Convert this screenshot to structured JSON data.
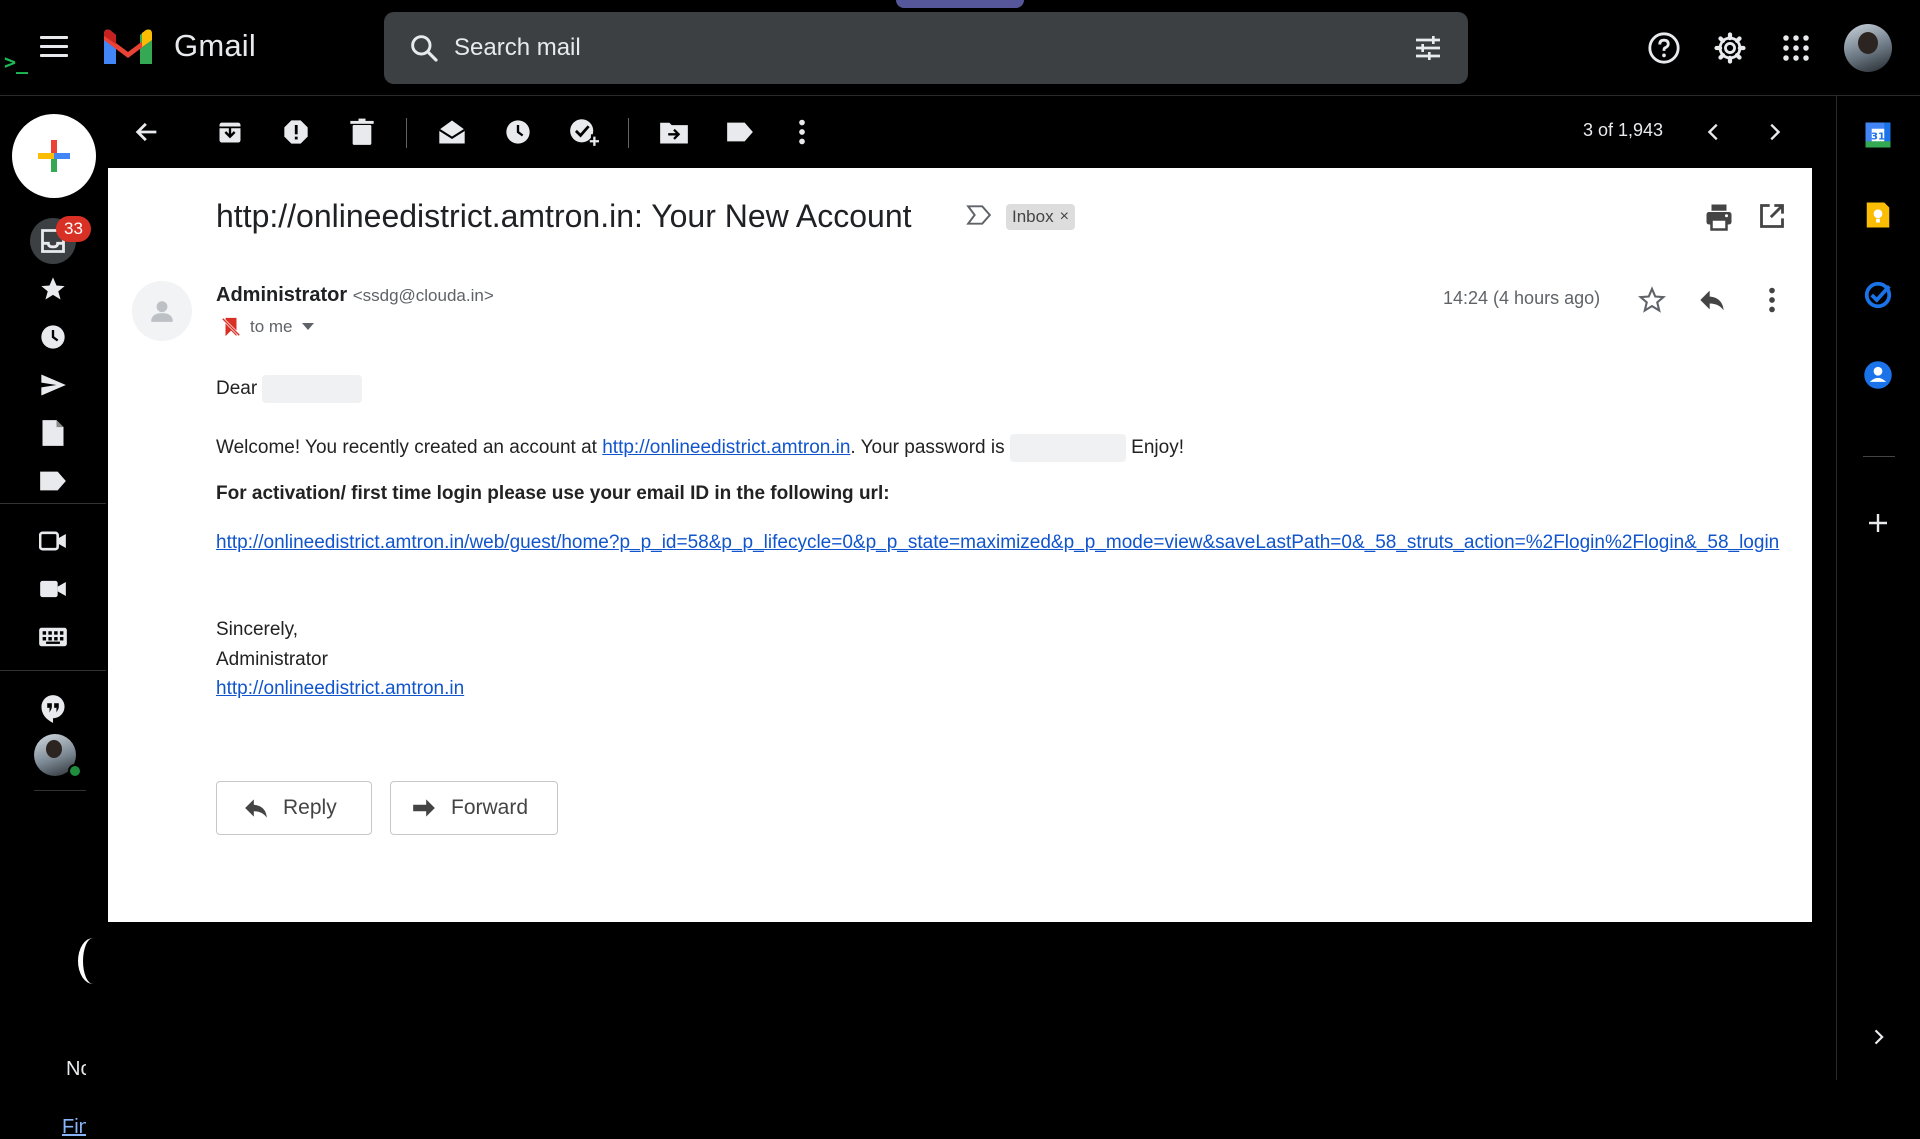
{
  "app": {
    "logo_text": "Gmail"
  },
  "search": {
    "placeholder": "Search mail"
  },
  "nav": {
    "inbox_badge": "33"
  },
  "toolbar": {
    "counter": "3 of 1,943"
  },
  "message": {
    "subject": "http://onlineedistrict.amtron.in: Your New Account",
    "label_chip": "Inbox",
    "label_chip_close": "×",
    "sender_name": "Administrator",
    "sender_email": "<ssdg@clouda.in>",
    "recipient": "to me",
    "timestamp": "14:24 (4 hours ago)",
    "body": {
      "greeting": "Dear",
      "welcome_prefix": "Welcome! You recently created an account at",
      "site_link": "http://onlineedistrict.amtron.in",
      "password_prefix": ". Your password is",
      "enjoy": "Enjoy!",
      "activation_note": "For activation/ first time login please use your email ID in the following url:",
      "login_url": "http://onlineedistrict.amtron.in/web/guest/home?p_p_id=58&p_p_lifecycle=0&p_p_state=maximized&p_p_mode=view&saveLastPath=0&_58_struts_action=%2Flogin%2Flogin&_58_login",
      "closing": "Sincerely,",
      "signature": "Administrator",
      "signature_link": "http://onlineedistrict.amtron.in"
    },
    "reply_label": "Reply",
    "forward_label": "Forward"
  },
  "sidebar_clipped": {
    "text": "No",
    "link": "Find"
  },
  "colors": {
    "background": "#000000",
    "search_bg": "#3c4043",
    "badge": "#d93025",
    "link": "#1155cc",
    "online": "#1e8e3e"
  }
}
